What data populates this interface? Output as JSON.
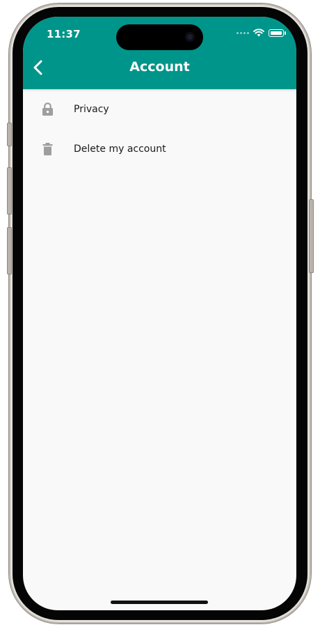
{
  "status_bar": {
    "time": "11:37",
    "icons": [
      "signal-dots-icon",
      "wifi-icon",
      "battery-icon"
    ]
  },
  "header": {
    "back_icon": "chevron-left-icon",
    "title": "Account"
  },
  "menu": {
    "items": [
      {
        "icon": "lock-icon",
        "label": "Privacy"
      },
      {
        "icon": "trash-icon",
        "label": "Delete my account"
      }
    ]
  },
  "colors": {
    "header": "#00958a",
    "background": "#f9f9f9",
    "icon": "#9e9e9e",
    "text": "#1a1a1a"
  }
}
